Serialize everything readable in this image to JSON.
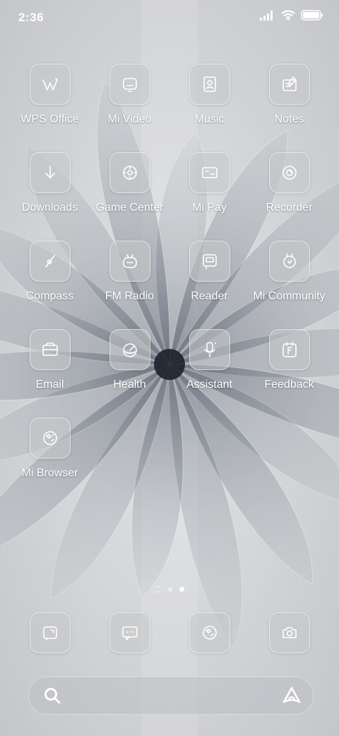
{
  "status_bar": {
    "time": "2:36"
  },
  "colors": {
    "label": "#ffffff",
    "tile_bg": "#c4c6c9"
  },
  "apps": [
    {
      "label": "WPS Office",
      "icon": "wps-office-icon"
    },
    {
      "label": "Mi Video",
      "icon": "mi-video-icon"
    },
    {
      "label": "Music",
      "icon": "music-icon"
    },
    {
      "label": "Notes",
      "icon": "notes-icon"
    },
    {
      "label": "Downloads",
      "icon": "downloads-icon"
    },
    {
      "label": "Game Center",
      "icon": "game-center-icon"
    },
    {
      "label": "Mi Pay",
      "icon": "mi-pay-icon"
    },
    {
      "label": "Recorder",
      "icon": "recorder-icon"
    },
    {
      "label": "Compass",
      "icon": "compass-icon"
    },
    {
      "label": "FM Radio",
      "icon": "fm-radio-icon"
    },
    {
      "label": "Reader",
      "icon": "reader-icon"
    },
    {
      "label": "Mi Community",
      "icon": "mi-community-icon"
    },
    {
      "label": "Email",
      "icon": "email-icon"
    },
    {
      "label": "Health",
      "icon": "health-icon"
    },
    {
      "label": "Assistant",
      "icon": "assistant-icon"
    },
    {
      "label": "Feedback",
      "icon": "feedback-icon"
    },
    {
      "label": "Mi Browser",
      "icon": "mi-browser-icon"
    }
  ],
  "page_indicator": {
    "pages": 2,
    "current": 2
  },
  "dock": [
    {
      "icon": "phone-icon"
    },
    {
      "icon": "messages-icon"
    },
    {
      "icon": "browser-icon"
    },
    {
      "icon": "camera-icon"
    }
  ],
  "search_bar": {
    "left_icon": "search-icon",
    "right_icon": "assistant-logo-icon"
  }
}
